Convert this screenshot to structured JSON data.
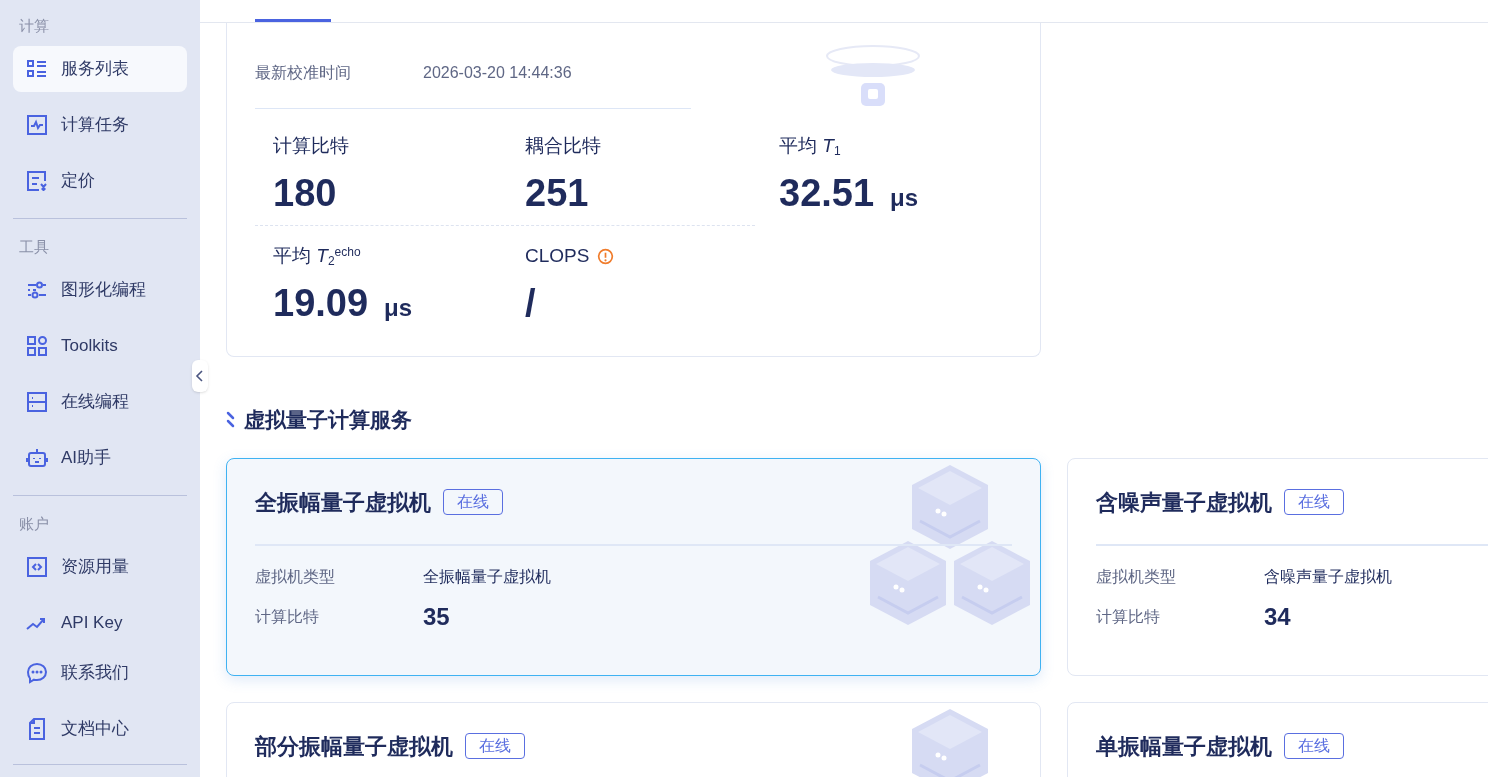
{
  "sidebar": {
    "groups": [
      {
        "label": "计算",
        "items": [
          {
            "label": "服务列表",
            "selected": true
          },
          {
            "label": "计算任务",
            "selected": false
          },
          {
            "label": "定价",
            "selected": false
          }
        ]
      },
      {
        "label": "工具",
        "items": [
          {
            "label": "图形化编程",
            "selected": false
          },
          {
            "label": "Toolkits",
            "selected": false
          },
          {
            "label": "在线编程",
            "selected": false
          },
          {
            "label": "AI助手",
            "selected": false
          }
        ]
      },
      {
        "label": "账户",
        "items": [
          {
            "label": "资源用量",
            "selected": false
          },
          {
            "label": "API Key",
            "selected": false
          }
        ]
      }
    ],
    "footer_items": [
      {
        "label": "联系我们",
        "selected": false
      },
      {
        "label": "文档中心",
        "selected": false
      }
    ]
  },
  "chip_card": {
    "calibration": {
      "label": "最新校准时间",
      "value": "2026-03-20 14:44:36"
    },
    "stats": [
      {
        "label": "计算比特",
        "value": "180"
      },
      {
        "label": "耦合比特",
        "value": "251"
      },
      {
        "label": "平均 *T*$_{1}$",
        "value": "32.51",
        "unit": "μs"
      },
      {
        "label": "平均 *T*$_{2}$$^{echo}$",
        "value": "19.09",
        "unit": "μs"
      },
      {
        "label": "CLOPS",
        "value": "/",
        "warning": true
      }
    ]
  },
  "section_title": "虚拟量子计算服务",
  "services": [
    {
      "title": "全振幅量子虚拟机",
      "status": "在线",
      "selected": true,
      "fields": [
        {
          "label": "虚拟机类型",
          "value": "全振幅量子虚拟机"
        },
        {
          "label": "计算比特",
          "value": "35"
        }
      ]
    },
    {
      "title": "含噪声量子虚拟机",
      "status": "在线",
      "selected": false,
      "fields": [
        {
          "label": "虚拟机类型",
          "value": "含噪声量子虚拟机"
        },
        {
          "label": "计算比特",
          "value": "34"
        }
      ]
    },
    {
      "title": "部分振幅量子虚拟机",
      "status": "在线",
      "selected": false
    },
    {
      "title": "单振幅量子虚拟机",
      "status": "在线",
      "selected": false
    }
  ]
}
